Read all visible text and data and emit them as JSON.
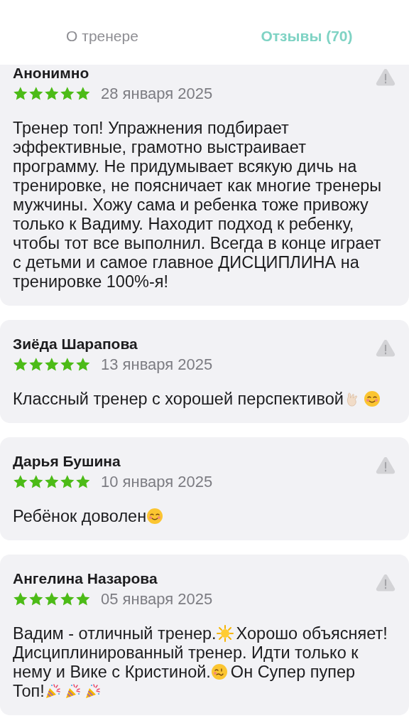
{
  "tabs": [
    {
      "label": "О тренере",
      "selected": false
    },
    {
      "label": "Отзывы (70)",
      "selected": true
    }
  ],
  "reviews": [
    {
      "author": "Анонимно",
      "stars": 5,
      "date": "28 января 2025",
      "body": [
        {
          "kind": "text",
          "text": "Тренер топ! Упражнения подбирает эффективные, грамотно выстраивает программу. Не придумывает всякую дичь на тренировке, не поясничает как многие тренеры мужчины. Хожу сама и ребенка тоже привожу только к Вадиму. Находит подход к ребенку, чтобы тот все выполнил. Всегда в конце играет с детьми и самое главное ДИСЦИПЛИНА на тренировке 100%-я!"
        }
      ]
    },
    {
      "author": "Зиёда Шарапова",
      "stars": 5,
      "date": "13 января 2025",
      "body": [
        {
          "kind": "text",
          "text": "Классный тренер с хорошей перспективой"
        },
        {
          "kind": "hand"
        },
        {
          "kind": "smile"
        }
      ]
    },
    {
      "author": "Дарья  Бушина",
      "stars": 5,
      "date": "10 января 2025",
      "body": [
        {
          "kind": "text",
          "text": "Ребёнок доволен"
        },
        {
          "kind": "smile"
        }
      ]
    },
    {
      "author": "Ангелина Назарова",
      "stars": 5,
      "date": "05 января 2025",
      "body": [
        {
          "kind": "text",
          "text": "Вадим - отличный тренер."
        },
        {
          "kind": "sun"
        },
        {
          "kind": "text",
          "text": "Хорошо объясняет! Дисциплинированный тренер. Идти только к нему и Вике с Кристиной."
        },
        {
          "kind": "woozy"
        },
        {
          "kind": "text",
          "text": "Он Супер пупер Топ!"
        },
        {
          "kind": "party"
        },
        {
          "kind": "party"
        },
        {
          "kind": "party"
        }
      ]
    }
  ]
}
